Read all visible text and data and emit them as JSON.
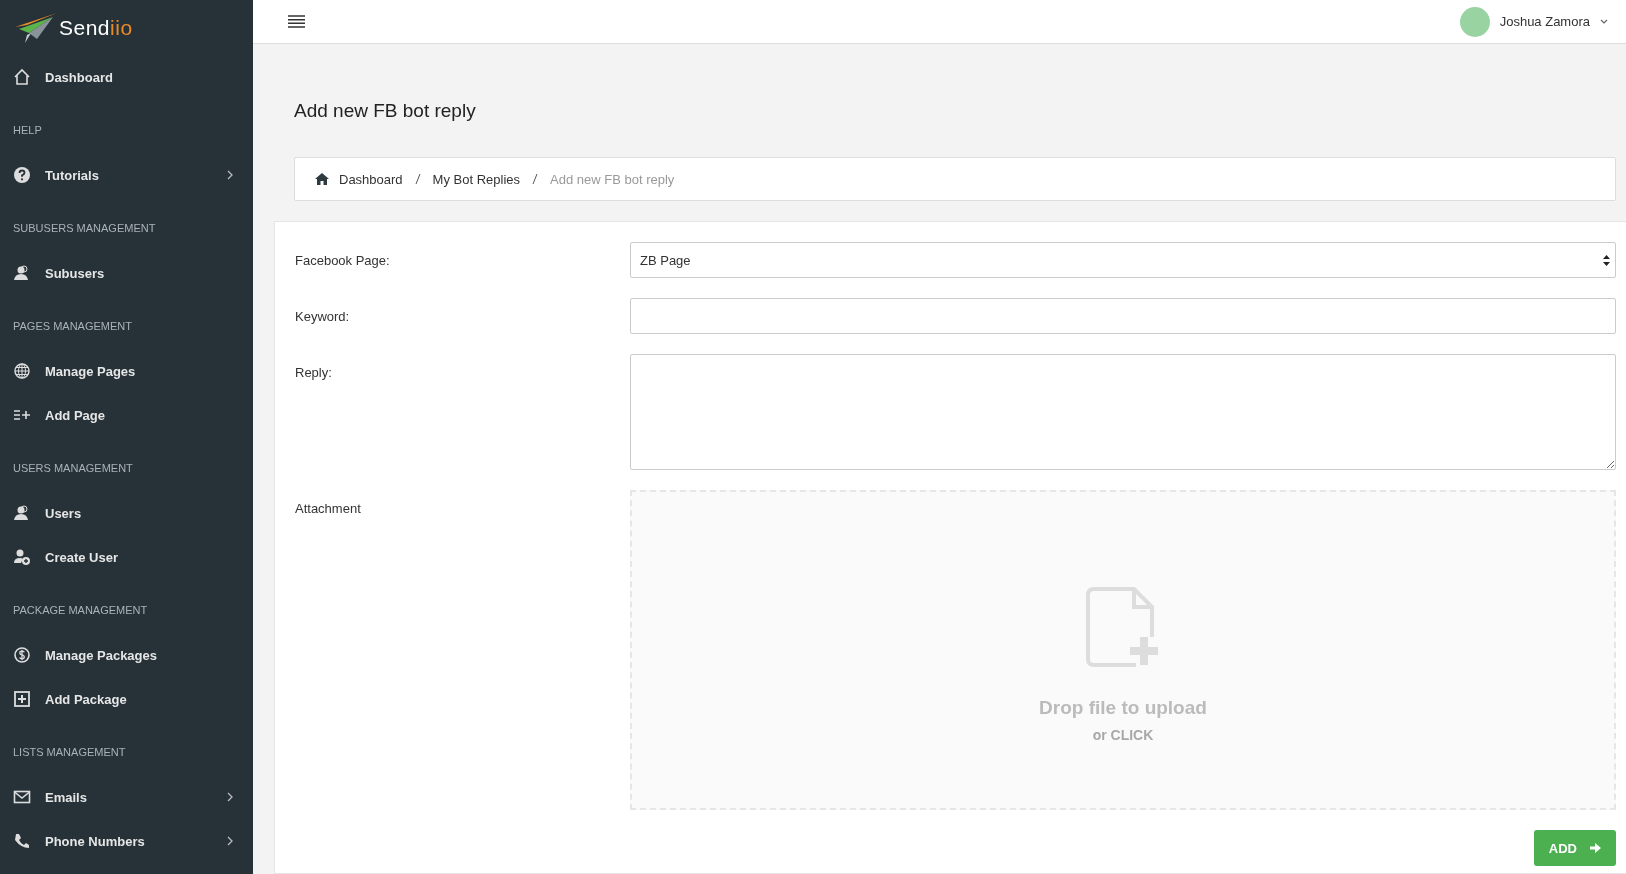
{
  "logo": {
    "text_main": "Send",
    "text_accent": "iio"
  },
  "sidebar": {
    "sections": [
      {
        "items": [
          {
            "label": "Dashboard",
            "submenu": false
          }
        ]
      },
      {
        "heading": "HELP",
        "items": [
          {
            "label": "Tutorials",
            "submenu": true
          }
        ]
      },
      {
        "heading": "SUBUSERS MANAGEMENT",
        "items": [
          {
            "label": "Subusers",
            "submenu": false
          }
        ]
      },
      {
        "heading": "PAGES MANAGEMENT",
        "items": [
          {
            "label": "Manage Pages",
            "submenu": false
          },
          {
            "label": "Add Page",
            "submenu": false
          }
        ]
      },
      {
        "heading": "USERS MANAGEMENT",
        "items": [
          {
            "label": "Users",
            "submenu": false
          },
          {
            "label": "Create User",
            "submenu": false
          }
        ]
      },
      {
        "heading": "PACKAGE MANAGEMENT",
        "items": [
          {
            "label": "Manage Packages",
            "submenu": false
          },
          {
            "label": "Add Package",
            "submenu": false
          }
        ]
      },
      {
        "heading": "LISTS MANAGEMENT",
        "items": [
          {
            "label": "Emails",
            "submenu": true
          },
          {
            "label": "Phone Numbers",
            "submenu": true
          }
        ]
      }
    ]
  },
  "user": {
    "name": "Joshua Zamora"
  },
  "page_title": "Add new FB bot reply",
  "breadcrumb": [
    {
      "label": "Dashboard",
      "current": false
    },
    {
      "label": "My Bot Replies",
      "current": false
    },
    {
      "label": "Add new FB bot reply",
      "current": true
    }
  ],
  "form": {
    "fields": [
      {
        "kind": "select",
        "label": "Facebook Page:",
        "value": "ZB Page"
      },
      {
        "kind": "text",
        "label": "Keyword:"
      },
      {
        "kind": "textarea",
        "label": "Reply:"
      },
      {
        "kind": "dropzone",
        "label": "Attachment",
        "title": "Drop file to upload",
        "subtitle": "or CLICK"
      }
    ],
    "submit": "ADD"
  }
}
